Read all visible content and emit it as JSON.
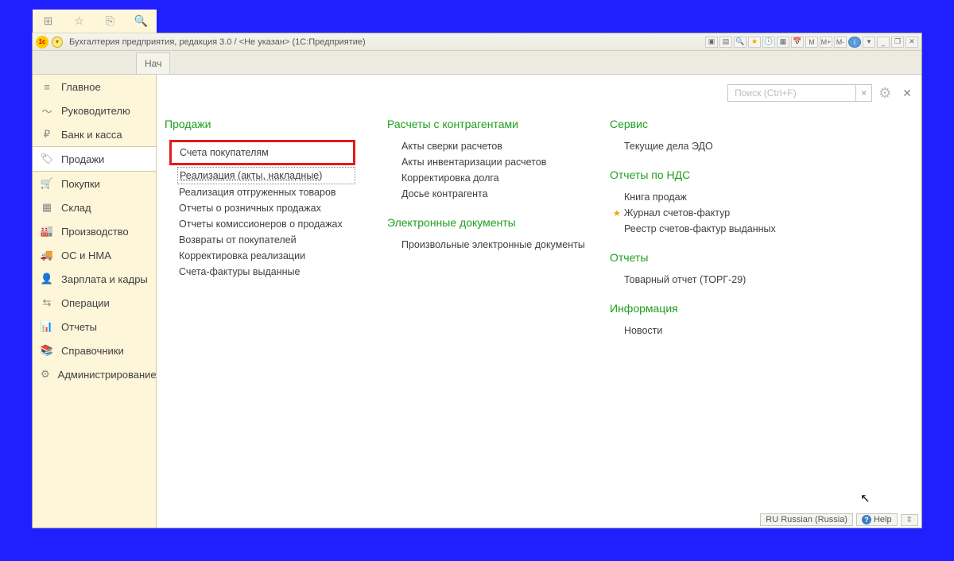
{
  "titlebar": {
    "app_icon_text": "1c",
    "title": "Бухгалтерия предприятия, редакция 3.0 / <Не указан>  (1С:Предприятие)",
    "win_btns": {
      "m": "M",
      "mplus": "M+",
      "mminus": "M-",
      "min": "_",
      "max": "❐",
      "close": "✕"
    }
  },
  "tabs": {
    "start": "Нач"
  },
  "sidebar": {
    "items": [
      {
        "icon": "≡",
        "label": "Главное"
      },
      {
        "icon": "〜",
        "label": "Руководителю"
      },
      {
        "icon": "₽",
        "label": "Банк и касса"
      },
      {
        "icon": "🏷",
        "label": "Продажи"
      },
      {
        "icon": "🛒",
        "label": "Покупки"
      },
      {
        "icon": "▦",
        "label": "Склад"
      },
      {
        "icon": "🏭",
        "label": "Производство"
      },
      {
        "icon": "🚚",
        "label": "ОС и НМА"
      },
      {
        "icon": "👤",
        "label": "Зарплата и кадры"
      },
      {
        "icon": "⇆",
        "label": "Операции"
      },
      {
        "icon": "📊",
        "label": "Отчеты"
      },
      {
        "icon": "📚",
        "label": "Справочники"
      },
      {
        "icon": "⚙",
        "label": "Администрирование"
      }
    ]
  },
  "search": {
    "placeholder": "Поиск (Ctrl+F)",
    "clear": "×"
  },
  "col1": {
    "title": "Продажи",
    "items": [
      "Счета покупателям",
      "Реализация (акты, накладные)",
      "Реализация отгруженных товаров",
      "Отчеты о розничных продажах",
      "Отчеты комиссионеров о продажах",
      "Возвраты от покупателей",
      "Корректировка реализации",
      "Счета-фактуры выданные"
    ]
  },
  "col2": {
    "section1": {
      "title": "Расчеты с контрагентами",
      "items": [
        "Акты сверки расчетов",
        "Акты инвентаризации расчетов",
        "Корректировка долга",
        "Досье контрагента"
      ]
    },
    "section2": {
      "title": "Электронные документы",
      "items": [
        "Произвольные электронные документы"
      ]
    }
  },
  "col3": {
    "section1": {
      "title": "Сервис",
      "items": [
        "Текущие дела ЭДО"
      ]
    },
    "section2": {
      "title": "Отчеты по НДС",
      "items": [
        "Книга продаж",
        "Журнал счетов-фактур",
        "Реестр счетов-фактур выданных"
      ]
    },
    "section3": {
      "title": "Отчеты",
      "items": [
        "Товарный отчет (ТОРГ-29)"
      ]
    },
    "section4": {
      "title": "Информация",
      "items": [
        "Новости"
      ]
    }
  },
  "statusbar": {
    "lang": "RU Russian (Russia)",
    "help": "Help"
  }
}
